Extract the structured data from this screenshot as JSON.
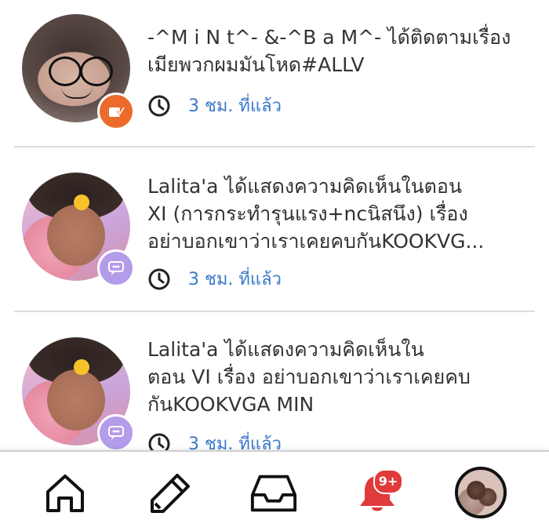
{
  "notifications": [
    {
      "lines": [
        "-^M i N t^- &-^B a M^- ได้ติดตามเรื่อง",
        "เมียพวกผมมันโหด#ALLV"
      ],
      "time": "3 ชม. ที่แล้ว",
      "badge_icon": "follow-book-icon",
      "badge_color": "#ec6a2b"
    },
    {
      "lines": [
        "Lalita'a ได้แสดงความคิดเห็นในตอน",
        "XI (การกระทำรุนแรง+ncนิสนึง) เรื่อง",
        "อย่าบอกเขาว่าเราเคยคบกันKOOKVG..."
      ],
      "time": "3 ชม. ที่แล้ว",
      "badge_icon": "comment-icon",
      "badge_color": "#b39ce9"
    },
    {
      "lines": [
        "Lalita'a ได้แสดงความคิดเห็นใน",
        "ตอน VI เรื่อง อย่าบอกเขาว่าเราเคยคบ",
        "กันKOOKVGA MIN"
      ],
      "time": "3 ชม. ที่แล้ว",
      "badge_icon": "comment-icon",
      "badge_color": "#b39ce9"
    }
  ],
  "bottom_nav": {
    "items": [
      "home-icon",
      "pencil-icon",
      "inbox-tray-icon",
      "bell-icon",
      "profile-avatar"
    ],
    "notification_count": "9+",
    "accent": "#e03a3a"
  }
}
